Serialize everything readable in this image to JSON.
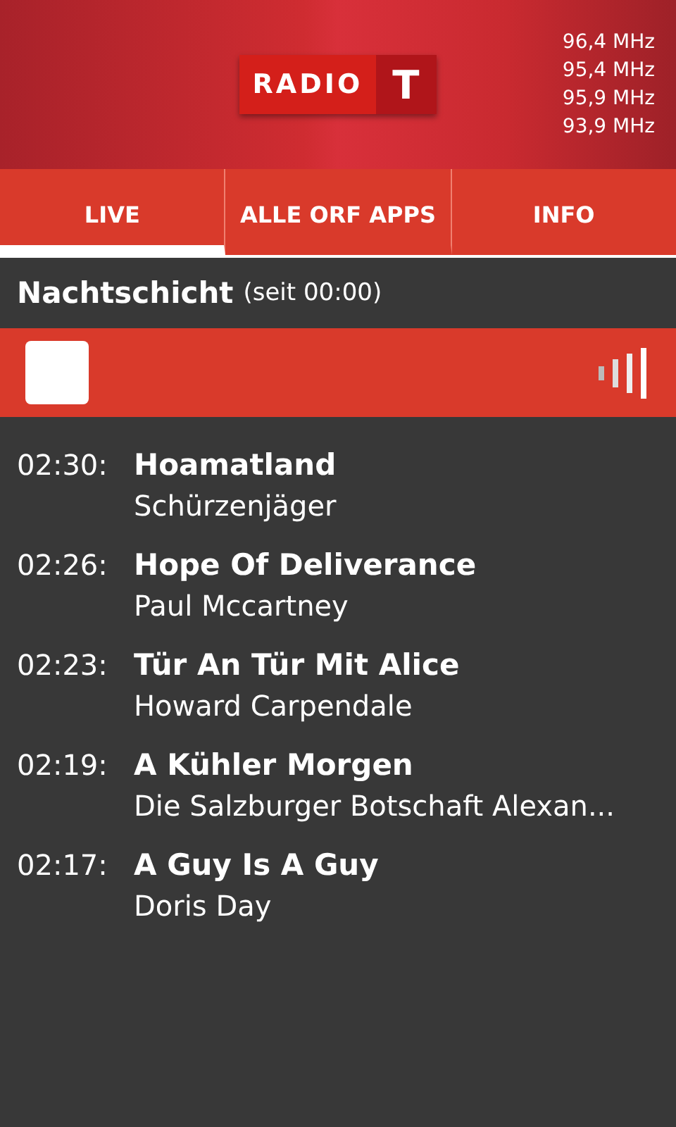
{
  "header": {
    "logo": {
      "word": "RADIO",
      "letter": "T"
    },
    "frequencies": [
      "96,4 MHz",
      "95,4 MHz",
      "95,9 MHz",
      "93,9 MHz"
    ]
  },
  "tabs": [
    {
      "label": "LIVE",
      "selected": true
    },
    {
      "label": "ALLE ORF APPS",
      "selected": false
    },
    {
      "label": "INFO",
      "selected": false
    }
  ],
  "show": {
    "title": "Nachtschicht",
    "since": "(seit 00:00)"
  },
  "player": {
    "playing": true
  },
  "playlist": [
    {
      "time": "02:30:",
      "title": "Hoamatland",
      "artist": "Schürzenjäger"
    },
    {
      "time": "02:26:",
      "title": "Hope Of Deliverance",
      "artist": "Paul Mccartney"
    },
    {
      "time": "02:23:",
      "title": "Tür An Tür Mit Alice",
      "artist": "Howard Carpendale"
    },
    {
      "time": "02:19:",
      "title": "A Kühler Morgen",
      "artist": "Die Salzburger Botschaft Alexan..."
    },
    {
      "time": "02:17:",
      "title": "A Guy Is A Guy",
      "artist": "Doris Day"
    }
  ]
}
